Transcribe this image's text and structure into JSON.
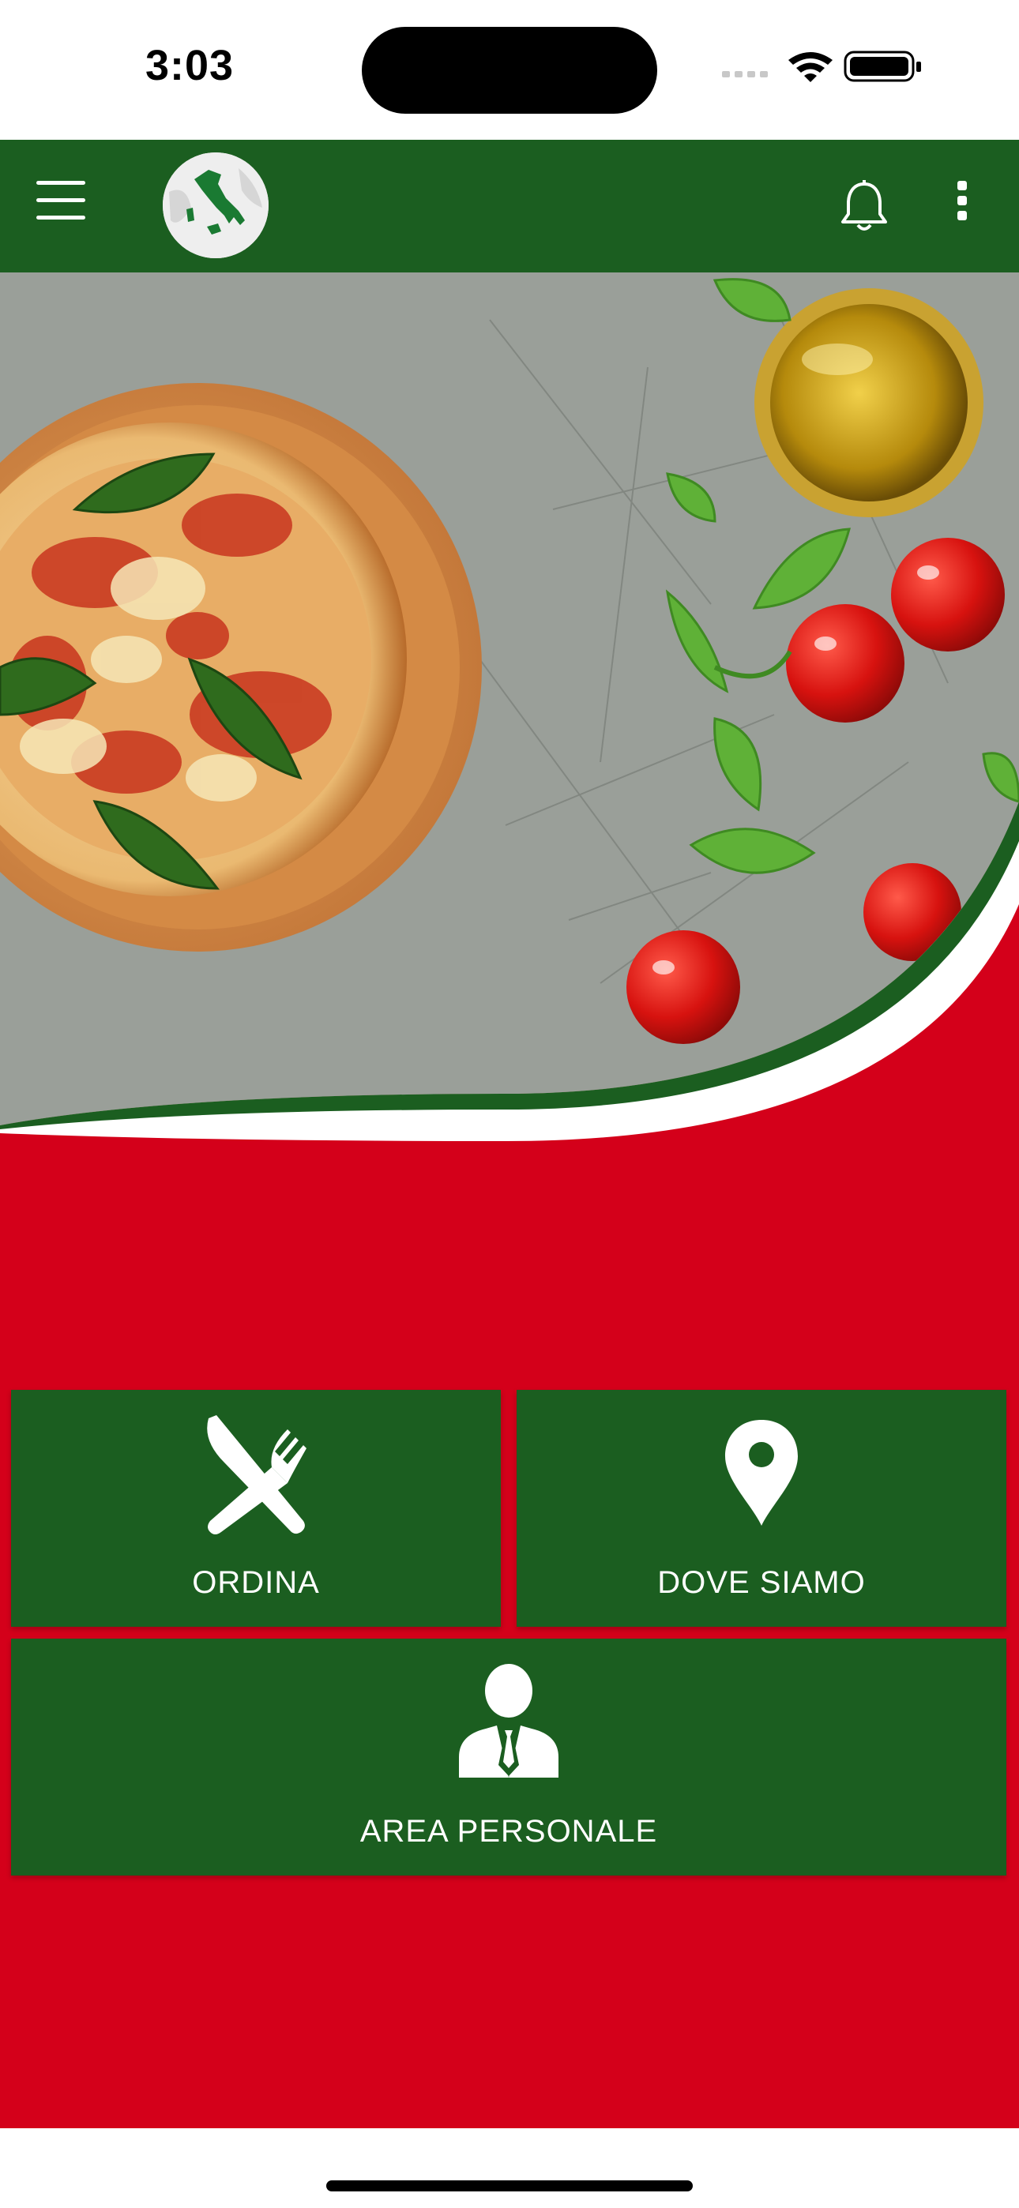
{
  "status": {
    "time": "3:03"
  },
  "header": {
    "menu_icon": "hamburger-menu-icon",
    "logo_icon": "italy-map-logo",
    "bell_icon": "bell-icon",
    "more_icon": "more-vertical-icon",
    "color": "#1b5e20"
  },
  "hero": {
    "image": "pizza-margherita-with-tomatoes-basil-and-olive-oil"
  },
  "tiles": [
    {
      "label": "ORDINA",
      "icon": "fork-knife-icon"
    },
    {
      "label": "DOVE SIAMO",
      "icon": "location-pin-icon"
    },
    {
      "label": "AREA PERSONALE",
      "icon": "person-icon"
    }
  ],
  "colors": {
    "green": "#1b5e20",
    "red": "#d4001a",
    "white": "#ffffff"
  }
}
